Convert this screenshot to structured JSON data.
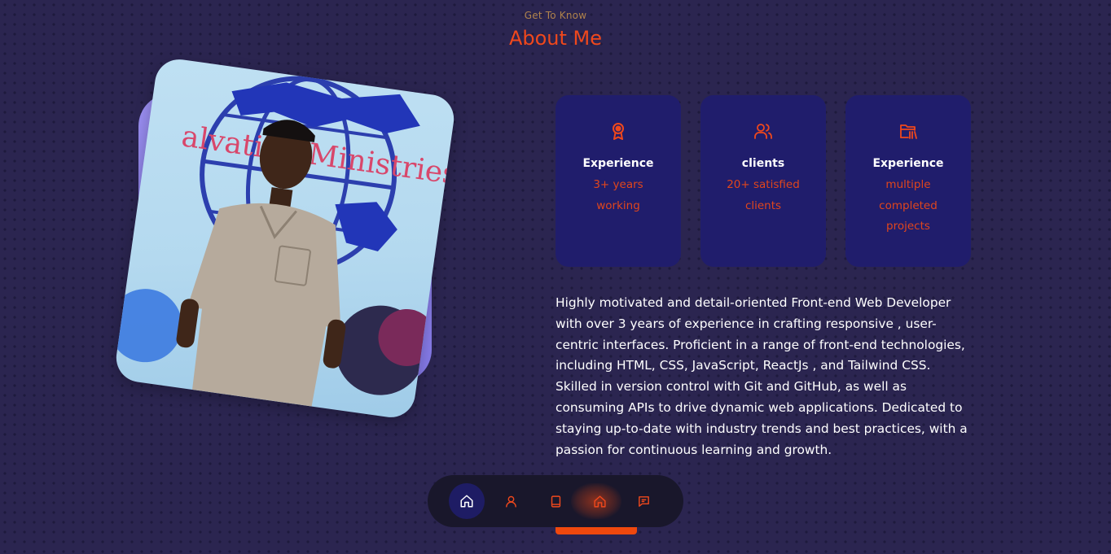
{
  "header": {
    "eyebrow": "Get To Know",
    "title": "About Me"
  },
  "photo": {
    "sign_text": "alvation Ministries"
  },
  "stats": [
    {
      "icon": "award-icon",
      "title": "Experience",
      "desc": "3+ years working"
    },
    {
      "icon": "users-icon",
      "title": "clients",
      "desc": "20+ satisfied clients"
    },
    {
      "icon": "folder-icon",
      "title": "Experience",
      "desc": "multiple completed projects"
    }
  ],
  "bio": "Highly motivated and detail-oriented Front-end Web Developer with over 3 years of experience in crafting responsive , user-centric interfaces. Proficient in a range of front-end technologies, including HTML, CSS, JavaScript, ReactJs , and Tailwind CSS. Skilled in version control with Git and GitHub, as well as consuming APIs to drive dynamic web applications. Dedicated to staying up-to-date with industry trends and best practices, with a passion for continuous learning and growth.",
  "nav": {
    "items": [
      {
        "icon": "home-icon",
        "active": true
      },
      {
        "icon": "user-icon",
        "active": false
      },
      {
        "icon": "book-icon",
        "active": false
      },
      {
        "icon": "home-icon",
        "active": false
      },
      {
        "icon": "message-icon",
        "active": false
      }
    ]
  },
  "colors": {
    "accent": "#f0481c",
    "background": "#2b2550",
    "card": "#201d6c",
    "nav": "#19172b"
  }
}
